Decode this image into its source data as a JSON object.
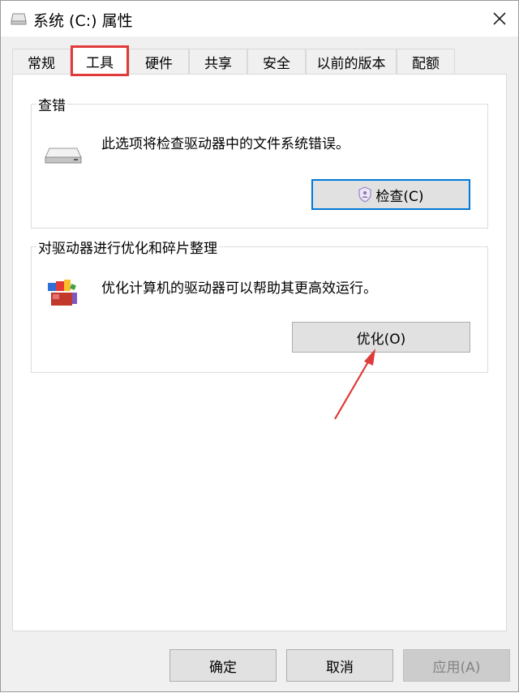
{
  "window": {
    "title": "系统 (C:) 属性"
  },
  "tabs": [
    {
      "label": "常规"
    },
    {
      "label": "工具"
    },
    {
      "label": "硬件"
    },
    {
      "label": "共享"
    },
    {
      "label": "安全"
    },
    {
      "label": "以前的版本"
    },
    {
      "label": "配额"
    }
  ],
  "selected_tab": "工具",
  "error_check": {
    "title": "查错",
    "description": "此选项将检查驱动器中的文件系统错误。",
    "button": "检查(C)"
  },
  "optimize": {
    "title": "对驱动器进行优化和碎片整理",
    "description": "优化计算机的驱动器可以帮助其更高效运行。",
    "button": "优化(O)"
  },
  "footer": {
    "ok": "确定",
    "cancel": "取消",
    "apply": "应用(A)"
  },
  "colors": {
    "highlight_box": "#e03a3a",
    "annotation_arrow": "#e03a3a",
    "default_button_border": "#0078d7"
  },
  "icons": {
    "title": "drive-icon",
    "close": "close-icon",
    "error_check": "hard-drive-icon",
    "optimize": "defrag-icon",
    "check_button": "uac-shield-icon"
  }
}
